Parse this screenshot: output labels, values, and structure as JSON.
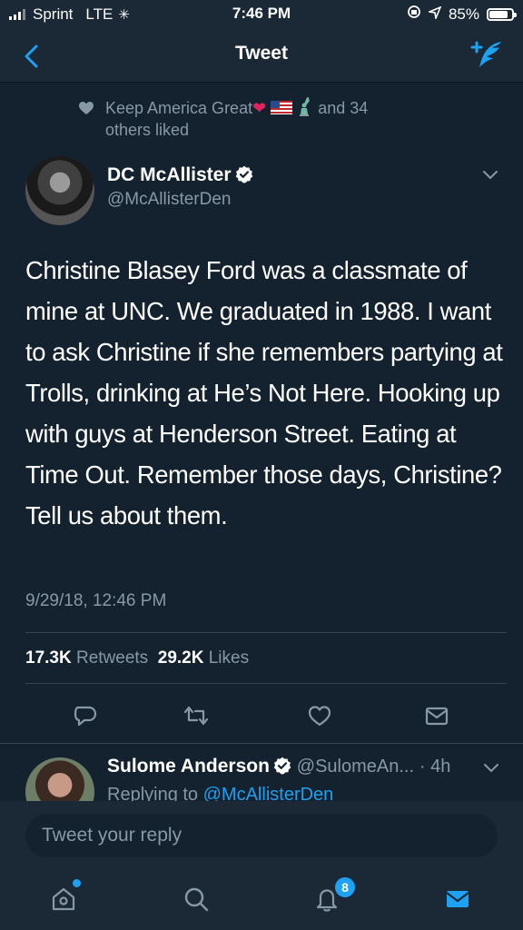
{
  "status_bar": {
    "carrier": "Sprint",
    "network": "LTE",
    "time": "7:46 PM",
    "battery": "85%",
    "battery_level": 0.85
  },
  "nav": {
    "title": "Tweet"
  },
  "liked_by": {
    "name": "Keep America Great",
    "others": "and 34",
    "suffix": "others liked"
  },
  "tweet": {
    "display_name": "DC McAllister",
    "handle": "@McAllisterDen",
    "text": "Christine Blasey Ford was a classmate of mine at UNC. We graduated in 1988. I want to ask Christine if she remembers partying at Trolls, drinking at He’s Not Here. Hooking up with guys at Henderson Street. Eating at Time Out. Remember those days, Christine? Tell us about them.",
    "timestamp": "9/29/18, 12:46 PM",
    "retweets_count": "17.3K",
    "retweets_label": "Retweets",
    "likes_count": "29.2K",
    "likes_label": "Likes"
  },
  "reply": {
    "display_name": "Sulome Anderson",
    "handle": "@SulomeAn...",
    "time": "· 4h",
    "replying_prefix": "Replying to",
    "replying_handle": "@McAllisterDen"
  },
  "compose": {
    "placeholder": "Tweet your reply"
  },
  "tab_bar": {
    "notifications_count": "8"
  },
  "colors": {
    "background": "#14212e",
    "bar": "#1b2836",
    "accent": "#1da1f2",
    "secondary_text": "#8899a6",
    "divider": "#38444d"
  }
}
